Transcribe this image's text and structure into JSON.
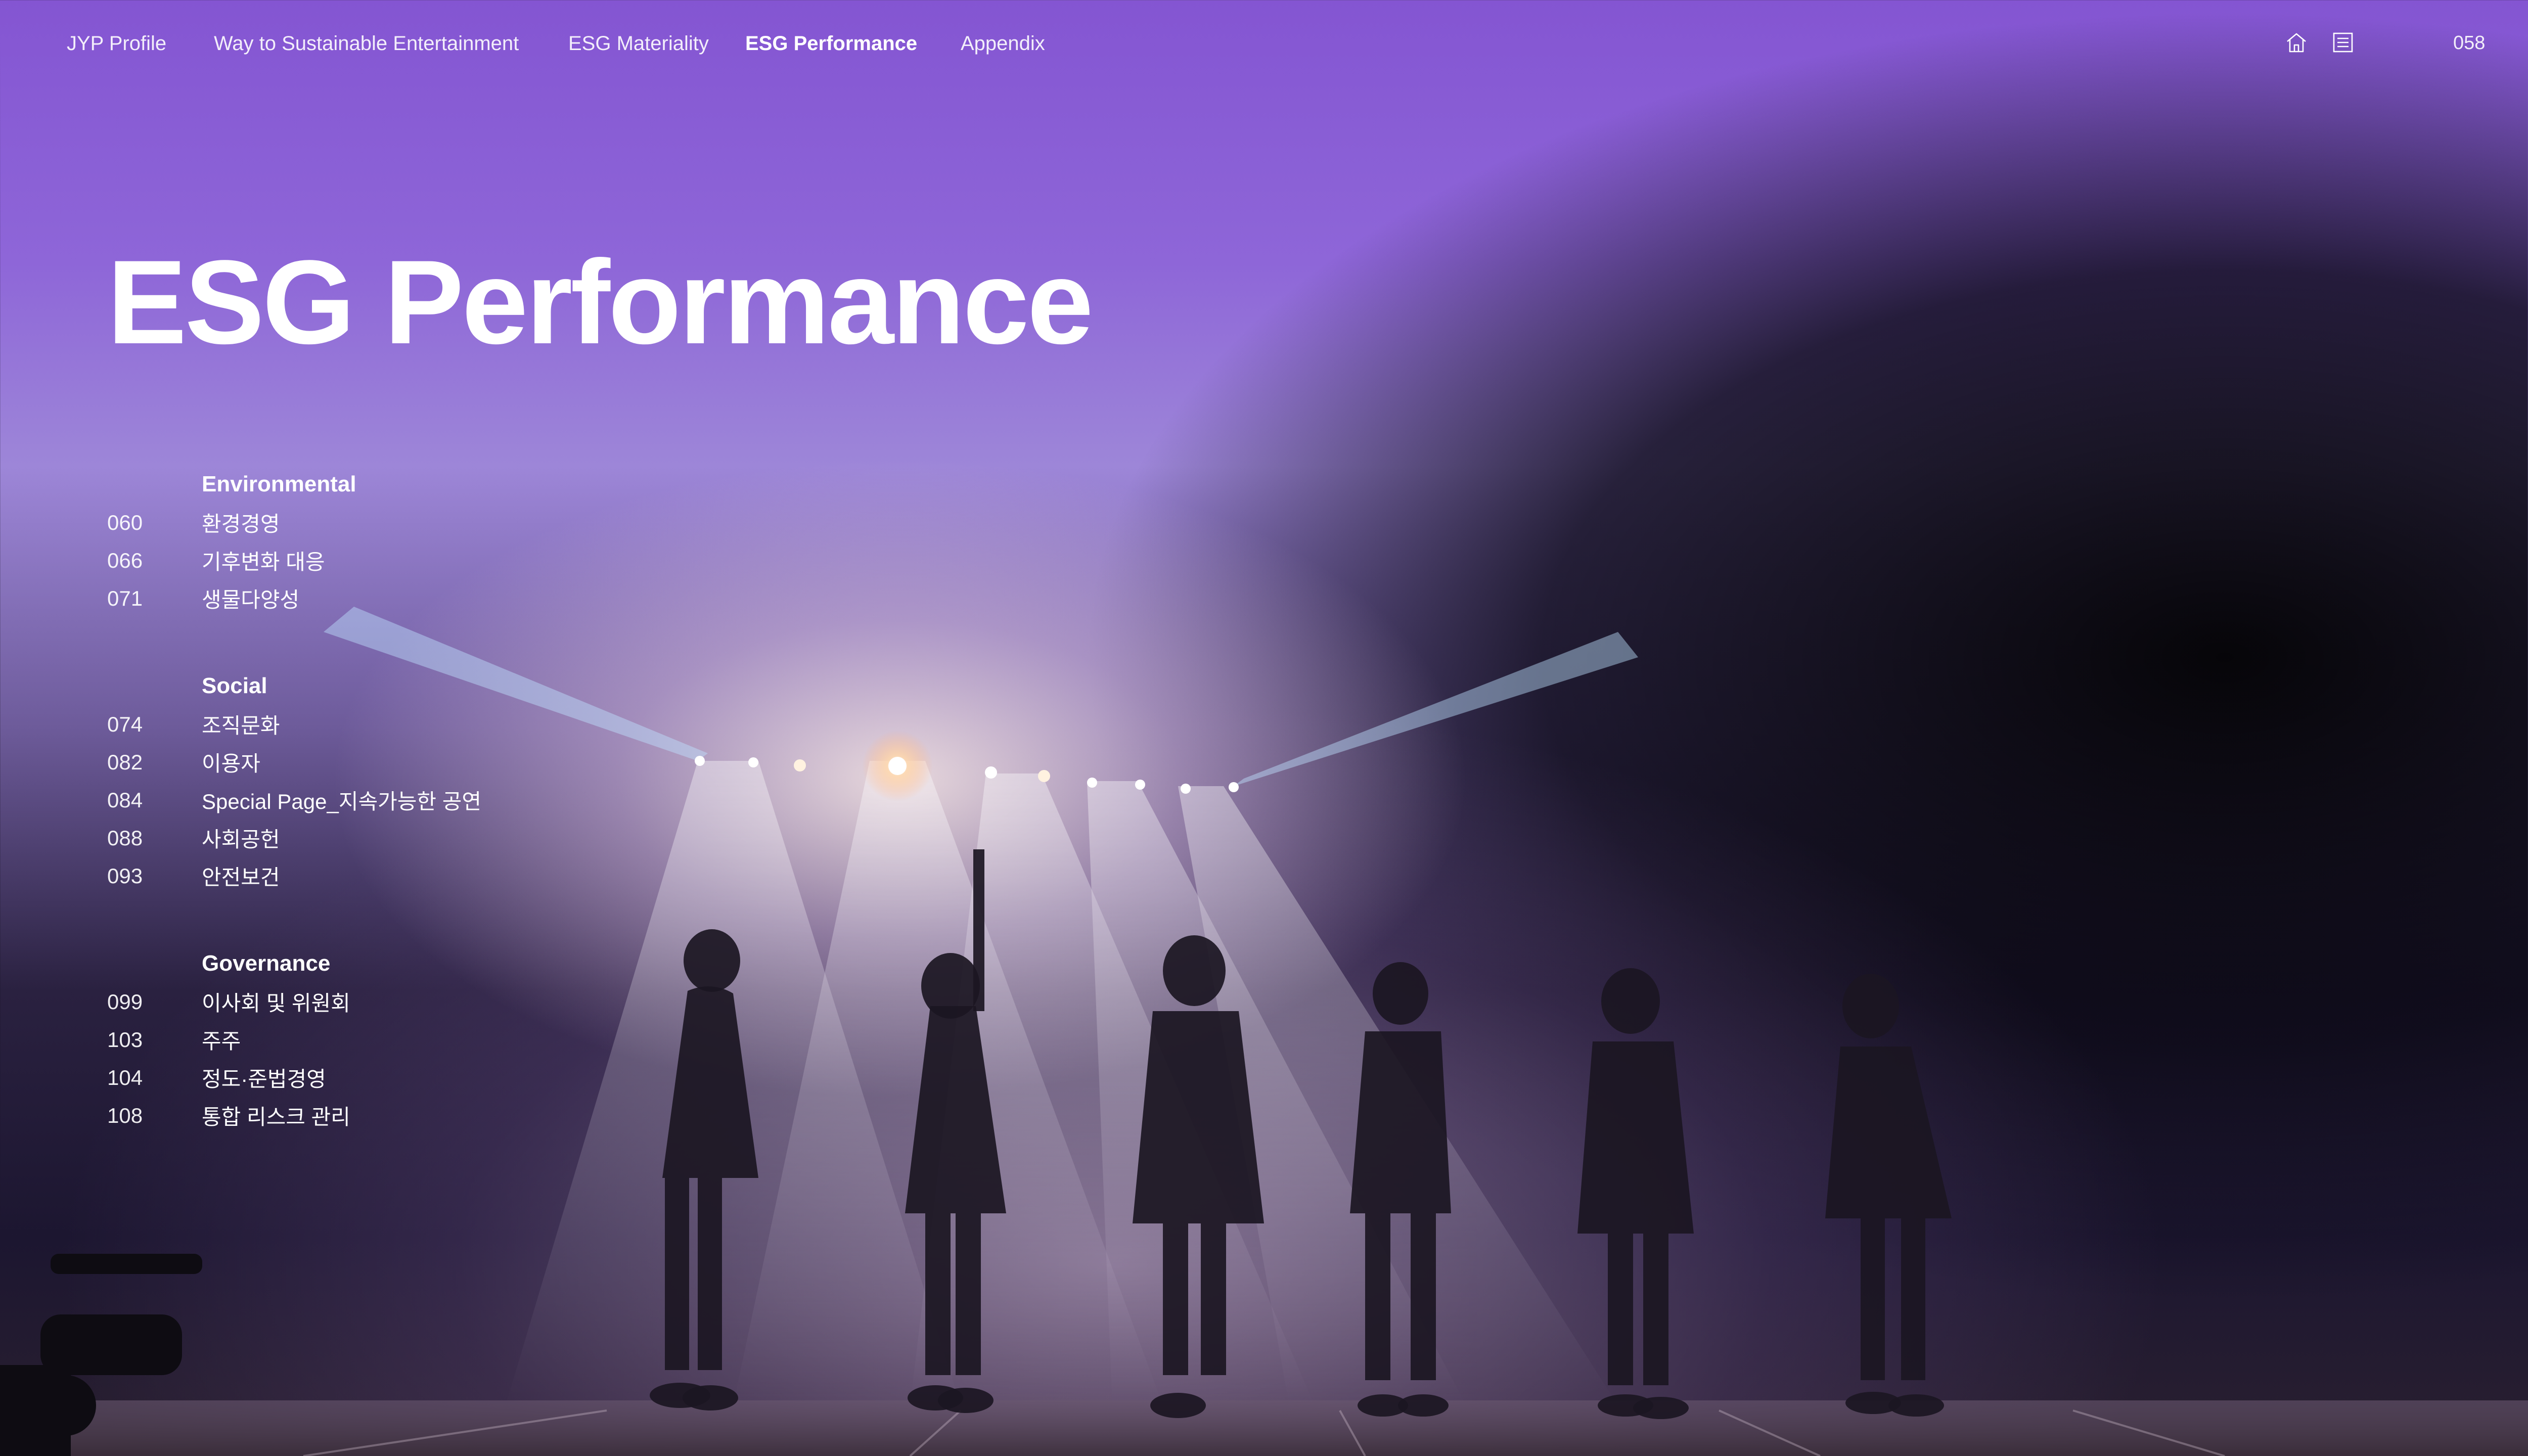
{
  "nav": {
    "items": [
      "JYP Profile",
      "Way to Sustainable Entertainment",
      "ESG Materiality",
      "ESG Performance",
      "Appendix"
    ],
    "active": "ESG Performance",
    "home_icon": "home-icon",
    "list_icon": "list-icon",
    "page_number": "058"
  },
  "title": "ESG Performance",
  "toc": {
    "environmental": {
      "heading": "Environmental",
      "items": [
        {
          "page": "060",
          "label": "환경경영"
        },
        {
          "page": "066",
          "label": "기후변화 대응"
        },
        {
          "page": "071",
          "label": "생물다양성"
        }
      ]
    },
    "social": {
      "heading": "Social",
      "items": [
        {
          "page": "074",
          "label": "조직문화"
        },
        {
          "page": "082",
          "label": "이용자"
        },
        {
          "page": "084",
          "label": "Special Page_지속가능한 공연"
        },
        {
          "page": "088",
          "label": "사회공헌"
        },
        {
          "page": "093",
          "label": "안전보건"
        }
      ]
    },
    "governance": {
      "heading": "Governance",
      "items": [
        {
          "page": "099",
          "label": "이사회 및 위원회"
        },
        {
          "page": "103",
          "label": "주주"
        },
        {
          "page": "104",
          "label": "정도·준법경영"
        },
        {
          "page": "108",
          "label": "통합 리스크 관리"
        }
      ]
    }
  }
}
